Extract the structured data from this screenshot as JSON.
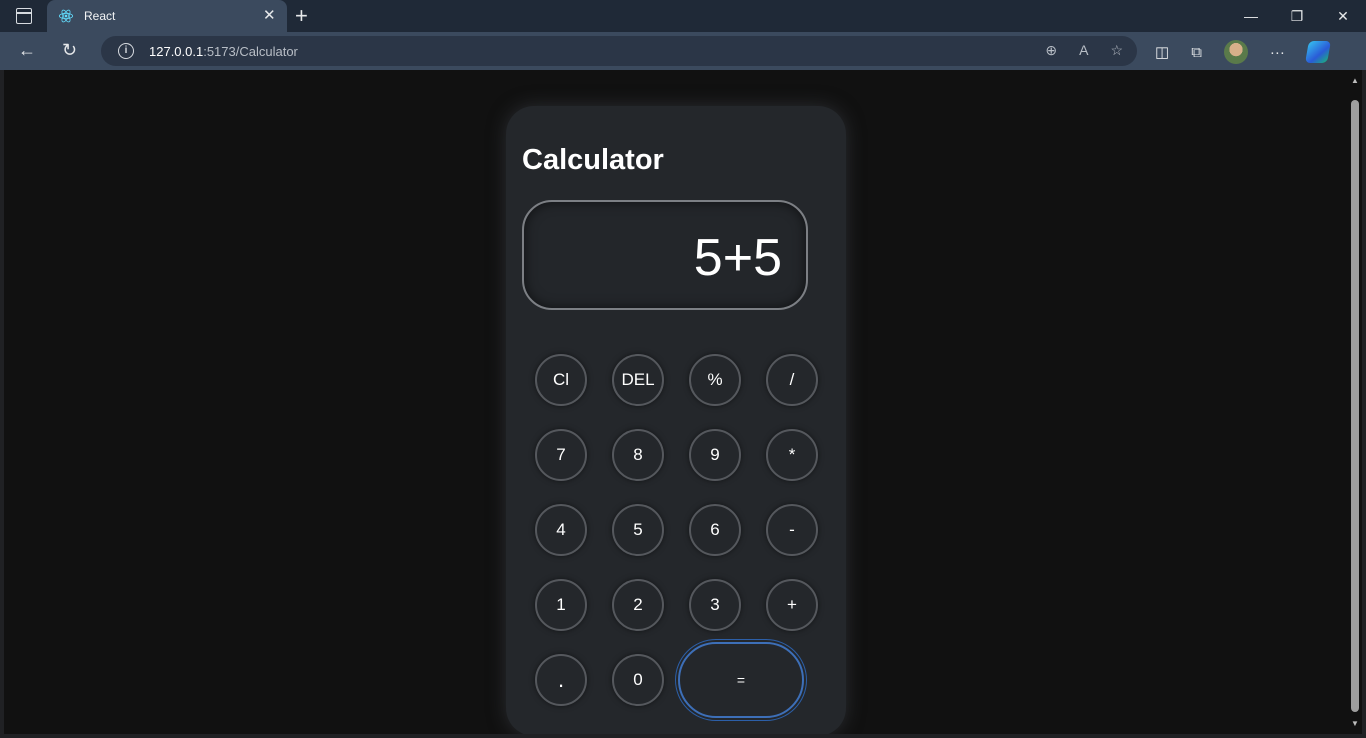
{
  "browser": {
    "tab_title": "React",
    "tab_close": "✕",
    "new_tab": "+",
    "url_host": "127.0.0.1",
    "url_path": ":5173/Calculator",
    "window_controls": {
      "minimize": "—",
      "restore": "❐",
      "close": "✕"
    },
    "nav": {
      "back": "←",
      "reload": "↻"
    },
    "address_icons": {
      "zoom": "⊕",
      "read_aloud": "A",
      "favorite": "☆"
    },
    "right_icons": {
      "split": "◫",
      "collections": "⧉",
      "menu": "···"
    }
  },
  "calculator": {
    "title": "Calculator",
    "display": "5+5",
    "keys": {
      "clear": "Cl",
      "del": "DEL",
      "percent": "%",
      "divide": "/",
      "seven": "7",
      "eight": "8",
      "nine": "9",
      "multiply": "*",
      "four": "4",
      "five": "5",
      "six": "6",
      "minus": "-",
      "one": "1",
      "two": "2",
      "three": "3",
      "plus": "+",
      "dot": ".",
      "zero": "0",
      "equals": "="
    }
  }
}
